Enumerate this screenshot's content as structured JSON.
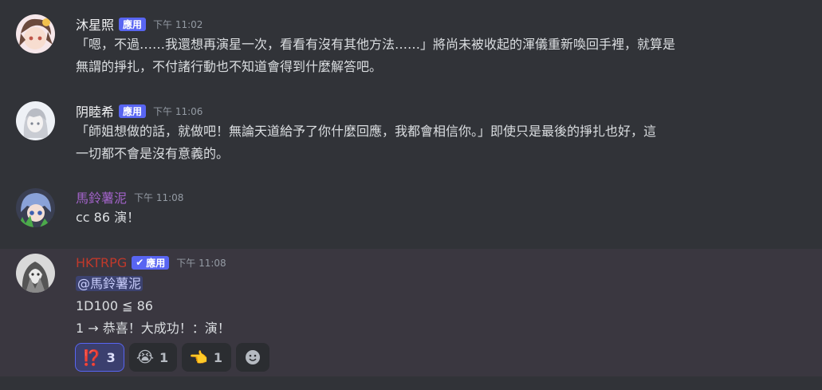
{
  "messages": [
    {
      "author": "沐星照",
      "author_color": "#f2f3f5",
      "badge": "應用",
      "time": "下午 11:02",
      "lines": [
        "「嗯，不過……我還想再演星一次，看看有沒有其他方法……」將尚未被收起的渾儀重新喚回手裡，就算是",
        "無謂的掙扎，不付諸行動也不知道會得到什麼解答吧。"
      ]
    },
    {
      "author": "阴睦希",
      "author_color": "#f2f3f5",
      "badge": "應用",
      "time": "下午 11:06",
      "lines": [
        "「師姐想做的話，就做吧！無論天道給予了你什麼回應，我都會相信你。」即使只是最後的掙扎也好，這",
        "一切都不會是沒有意義的。"
      ]
    },
    {
      "author": "馬鈴薯泥",
      "author_color": "#a263c9",
      "time": "下午 11:08",
      "lines": [
        "cc 86 演！"
      ]
    },
    {
      "author": "HKTRPG",
      "author_color": "#c0392b",
      "badge": "應用",
      "time": "下午 11:08",
      "mention": "@馬鈴薯泥",
      "lines": [
        "1D100 ≦ 86",
        "1 → 恭喜！大成功！：演！"
      ],
      "reactions": [
        {
          "emoji": "⁉️",
          "icon": "exclamation-question-icon",
          "count": "3",
          "active": true
        },
        {
          "emoji": "😭",
          "icon": "crying-face-icon",
          "count": "1",
          "active": false
        },
        {
          "emoji": "👈",
          "icon": "pointing-hand-icon",
          "count": "1",
          "active": false
        }
      ]
    }
  ]
}
